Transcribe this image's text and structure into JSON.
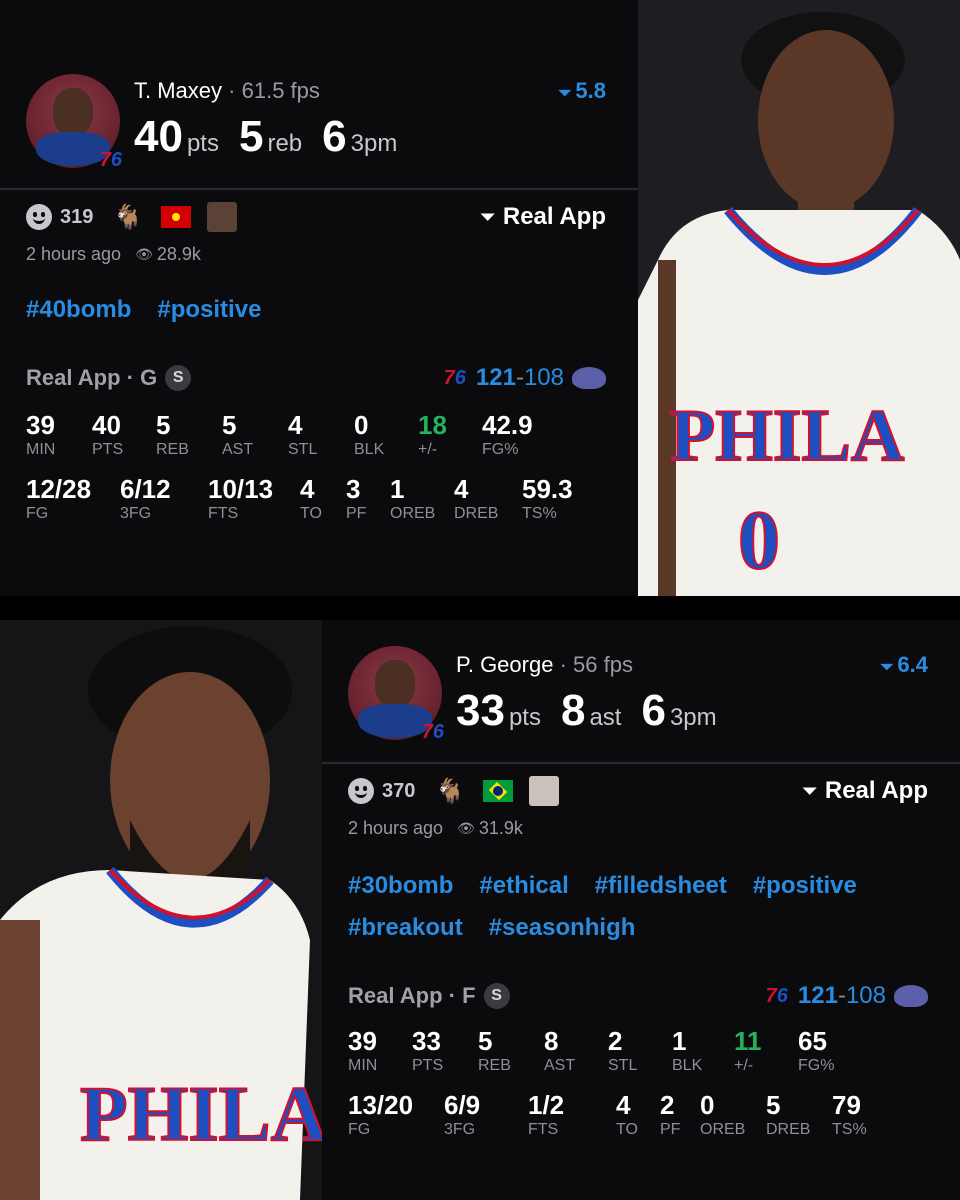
{
  "cards": [
    {
      "player": "T. Maxey",
      "fps": "61.5 fps",
      "score": "5.8",
      "big": [
        {
          "num": "40",
          "unit": "pts"
        },
        {
          "num": "5",
          "unit": "reb"
        },
        {
          "num": "6",
          "unit": "3pm"
        }
      ],
      "reactions": "319",
      "time": "2 hours ago",
      "views": "28.9k",
      "tags": [
        "#40bomb",
        "#positive"
      ],
      "source": "Real App · G",
      "s_badge": "S",
      "game": {
        "home": "121",
        "away": "108"
      },
      "row1": [
        {
          "v": "39",
          "l": "MIN"
        },
        {
          "v": "40",
          "l": "PTS"
        },
        {
          "v": "5",
          "l": "REB"
        },
        {
          "v": "5",
          "l": "AST"
        },
        {
          "v": "4",
          "l": "STL"
        },
        {
          "v": "0",
          "l": "BLK"
        },
        {
          "v": "18",
          "l": "+/-"
        },
        {
          "v": "42.9",
          "l": "FG%"
        }
      ],
      "row2": [
        {
          "v": "12/28",
          "l": "FG"
        },
        {
          "v": "6/12",
          "l": "3FG"
        },
        {
          "v": "10/13",
          "l": "FTS"
        },
        {
          "v": "4",
          "l": "TO"
        },
        {
          "v": "3",
          "l": "PF"
        },
        {
          "v": "1",
          "l": "OREB"
        },
        {
          "v": "4",
          "l": "DREB"
        },
        {
          "v": "59.3",
          "l": "TS%"
        }
      ]
    },
    {
      "player": "P. George",
      "fps": "56 fps",
      "score": "6.4",
      "big": [
        {
          "num": "33",
          "unit": "pts"
        },
        {
          "num": "8",
          "unit": "ast"
        },
        {
          "num": "6",
          "unit": "3pm"
        }
      ],
      "reactions": "370",
      "time": "2 hours ago",
      "views": "31.9k",
      "tags": [
        "#30bomb",
        "#ethical",
        "#filledsheet",
        "#positive",
        "#breakout",
        "#seasonhigh"
      ],
      "source": "Real App · F",
      "s_badge": "S",
      "game": {
        "home": "121",
        "away": "108"
      },
      "row1": [
        {
          "v": "39",
          "l": "MIN"
        },
        {
          "v": "33",
          "l": "PTS"
        },
        {
          "v": "5",
          "l": "REB"
        },
        {
          "v": "8",
          "l": "AST"
        },
        {
          "v": "2",
          "l": "STL"
        },
        {
          "v": "1",
          "l": "BLK"
        },
        {
          "v": "11",
          "l": "+/-"
        },
        {
          "v": "65",
          "l": "FG%"
        }
      ],
      "row2": [
        {
          "v": "13/20",
          "l": "FG"
        },
        {
          "v": "6/9",
          "l": "3FG"
        },
        {
          "v": "1/2",
          "l": "FTS"
        },
        {
          "v": "4",
          "l": "TO"
        },
        {
          "v": "2",
          "l": "PF"
        },
        {
          "v": "0",
          "l": "OREB"
        },
        {
          "v": "5",
          "l": "DREB"
        },
        {
          "v": "79",
          "l": "TS%"
        }
      ]
    }
  ],
  "labels": {
    "real_app": "Real App",
    "team_home_a": "7",
    "team_home_b": "6",
    "jersey_text": "PHILA",
    "jersey_number": "0"
  },
  "colors": {
    "accent": "#2a8ce0",
    "positive": "#24b35c",
    "background": "#0b0b0d"
  }
}
